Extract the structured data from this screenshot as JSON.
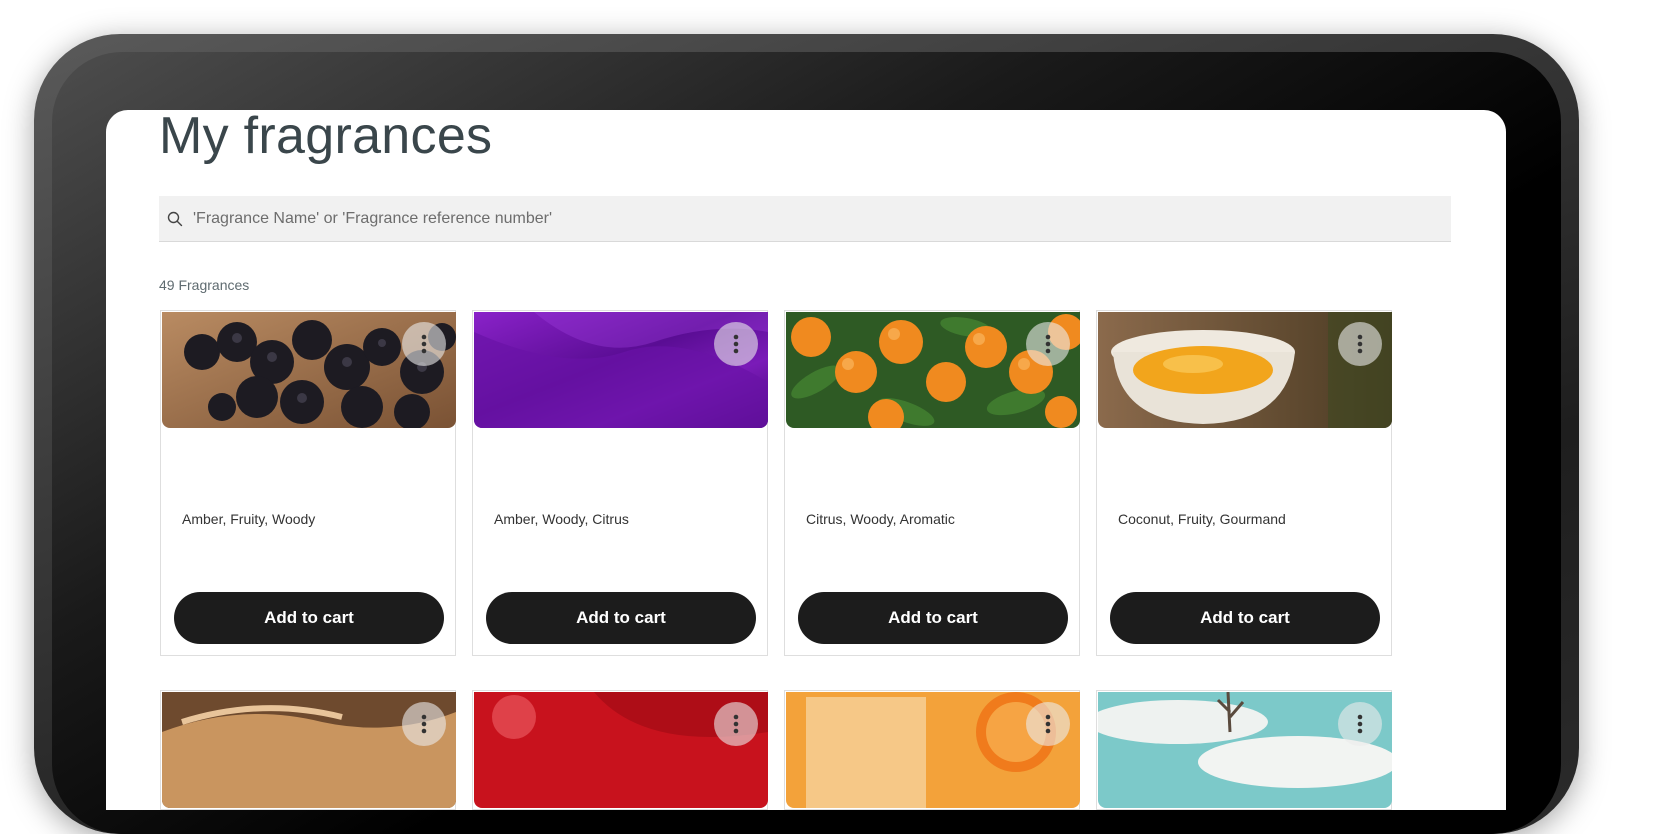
{
  "page": {
    "title": "My fragrances",
    "search_placeholder": "'Fragrance Name' or 'Fragrance reference number'",
    "count_label": "49 Fragrances"
  },
  "icons": {
    "search": "search-icon",
    "more": "more-vertical-icon"
  },
  "colors": {
    "title": "#3a464b",
    "button_bg": "#1c1c1c",
    "button_text": "#ffffff",
    "search_bg": "#f1f1f1"
  },
  "cards": [
    {
      "notes": "Amber, Fruity, Woody",
      "button": "Add to cart",
      "image": "blackberries"
    },
    {
      "notes": "Amber, Woody, Citrus",
      "button": "Add to cart",
      "image": "purple-velvet"
    },
    {
      "notes": "Citrus, Woody, Aromatic",
      "button": "Add to cart",
      "image": "oranges-on-tree"
    },
    {
      "notes": "Coconut, Fruity, Gourmand",
      "button": "Add to cart",
      "image": "orange-jam-bowl"
    }
  ],
  "cards_row2": [
    {
      "image": "pastry-strudel"
    },
    {
      "image": "red-fabric"
    },
    {
      "image": "citrus-drink"
    },
    {
      "image": "white-terraces"
    }
  ]
}
